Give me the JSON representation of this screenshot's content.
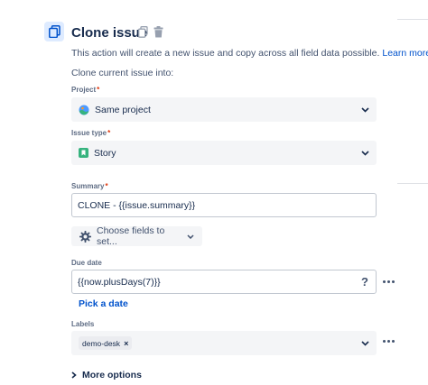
{
  "header": {
    "title": "Clone issue",
    "description": "This action will create a new issue and copy across all field data possible.",
    "learn_more": "Learn more.",
    "subheading": "Clone current issue into:"
  },
  "fields": {
    "project": {
      "label": "Project",
      "required": "*",
      "value": "Same project"
    },
    "issue_type": {
      "label": "Issue type",
      "required": "*",
      "value": "Story"
    },
    "summary": {
      "label": "Summary",
      "required": "*",
      "value": "CLONE - {{issue.summary}}"
    },
    "choose_fields": {
      "label": "Choose fields to set..."
    },
    "due_date": {
      "label": "Due date",
      "value": "{{now.plusDays(7)}}",
      "help": "?",
      "pick_link": "Pick a date"
    },
    "labels": {
      "label": "Labels",
      "tags": [
        "demo-desk"
      ],
      "remove": "×"
    }
  },
  "more_options": "More options",
  "colors": {
    "accent": "#0052cc",
    "required": "#de350b",
    "story": "#36b37e"
  }
}
